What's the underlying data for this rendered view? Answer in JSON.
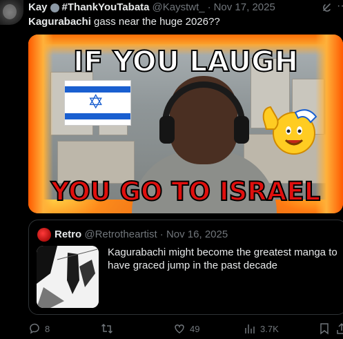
{
  "tweet": {
    "author_name": "Kay",
    "hashtag": "#ThankYouTabata",
    "handle": "@Kaystwt_",
    "separator": "·",
    "date": "Nov 17, 2025",
    "more_label": "···",
    "text_bold": "Kagurabachi",
    "text_rest": " gass near the huge 2026??"
  },
  "media": {
    "caption_top": "IF YOU LAUGH",
    "caption_bottom": "YOU GO TO ISRAEL",
    "flag_star": "✡"
  },
  "quote": {
    "author_name": "Retro",
    "handle": "@Retrotheartist",
    "separator": "·",
    "date": "Nov 16, 2025",
    "text": "Kagurabachi might become the greatest manga to have graced jump in the past decade"
  },
  "actions": {
    "reply_count": "8",
    "retweet_count": "",
    "like_count": "49",
    "view_count": "3.7K"
  },
  "icons": {
    "reply": "reply-icon",
    "retweet": "retweet-icon",
    "like": "heart-icon",
    "views": "views-icon",
    "bookmark": "bookmark-icon",
    "grok": "grok-icon"
  },
  "colors": {
    "background": "#000000",
    "text": "#e7e9ea",
    "muted": "#71767b",
    "border": "#2f3336",
    "caption_red": "#e0100e"
  }
}
